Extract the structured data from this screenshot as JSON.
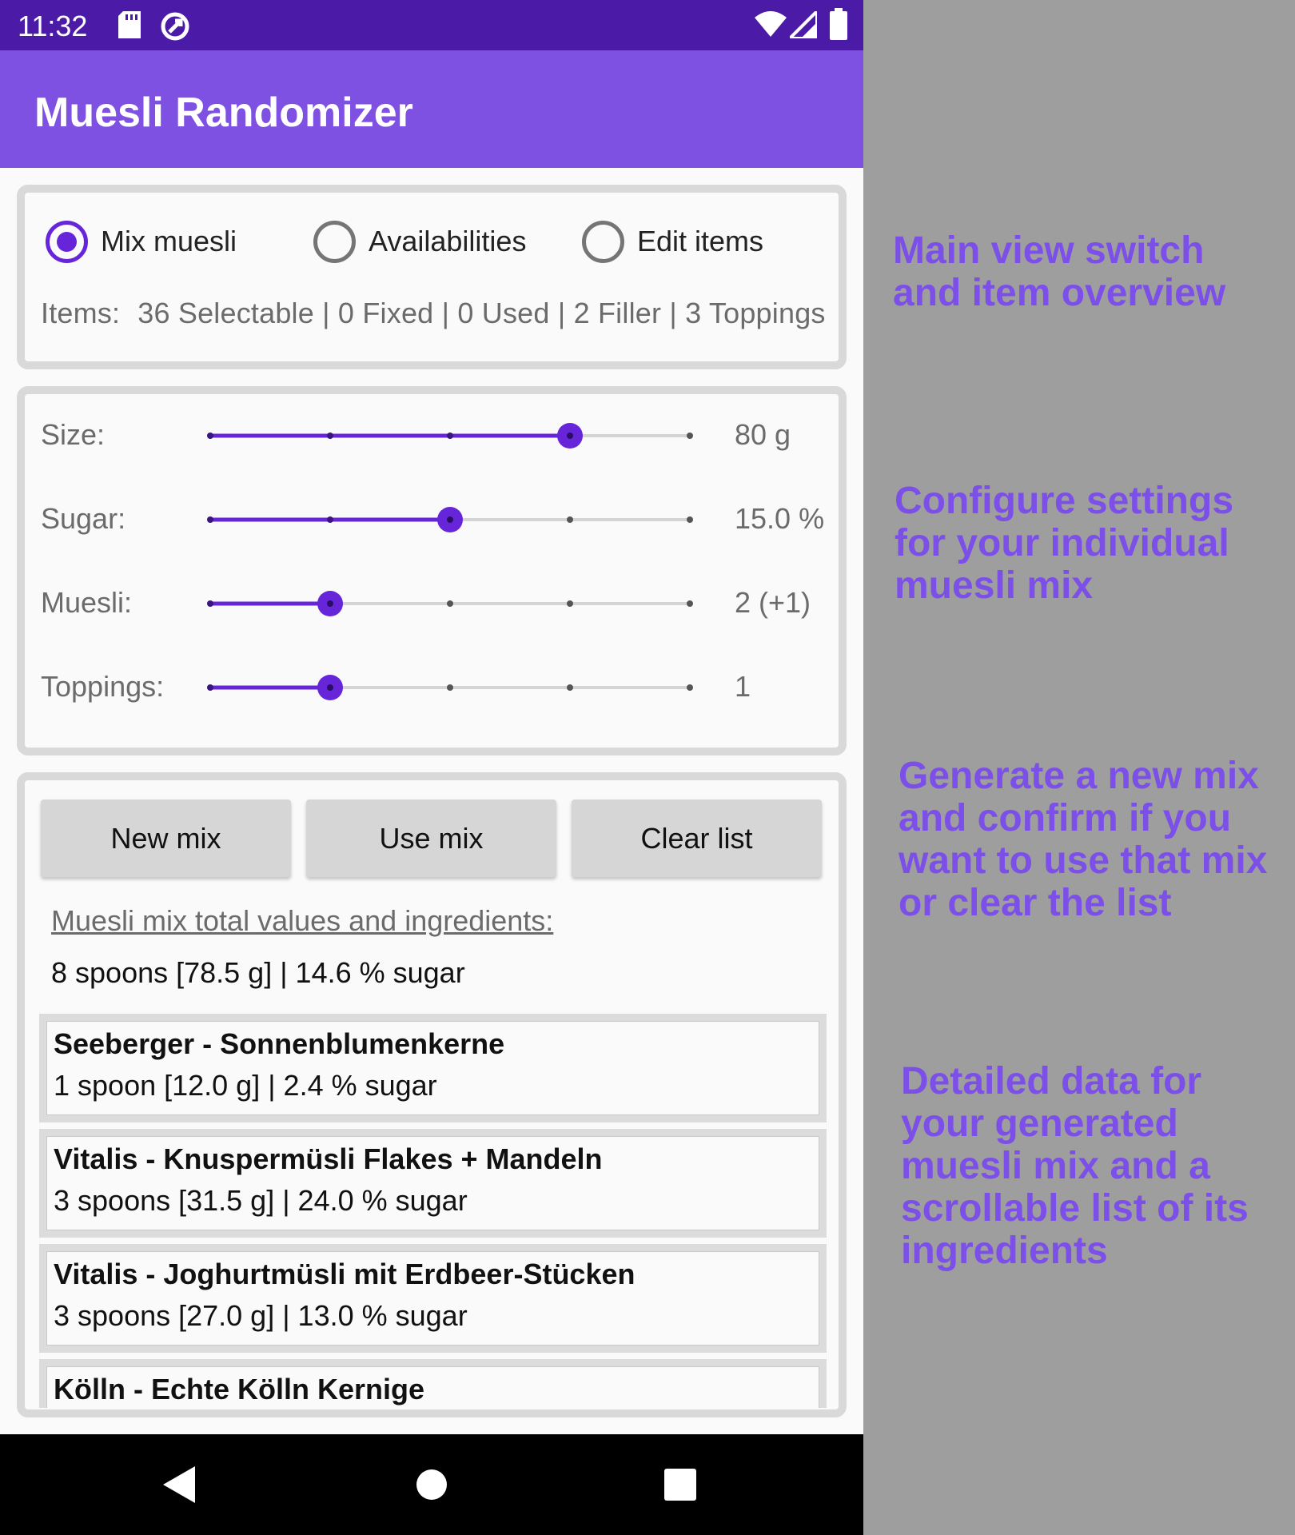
{
  "status_bar": {
    "time": "11:32",
    "icons": [
      "sd-card-icon",
      "sync-circle-icon",
      "wifi-icon",
      "signal-icon",
      "battery-icon"
    ]
  },
  "app_bar": {
    "title": "Muesli Randomizer",
    "color": "#7e51e3"
  },
  "view_switch": {
    "options": [
      {
        "label": "Mix muesli",
        "checked": true
      },
      {
        "label": "Availabilities",
        "checked": false
      },
      {
        "label": "Edit items",
        "checked": false
      }
    ],
    "items_label": "Items:",
    "items_summary": "36 Selectable | 0 Fixed | 0 Used | 2 Filler | 3 Toppings"
  },
  "settings": [
    {
      "label": "Size:",
      "value": "80 g",
      "steps": 5,
      "position": 3
    },
    {
      "label": "Sugar:",
      "value": "15.0 %",
      "steps": 5,
      "position": 2
    },
    {
      "label": "Muesli:",
      "value": "2 (+1)",
      "steps": 5,
      "position": 1
    },
    {
      "label": "Toppings:",
      "value": "1",
      "steps": 5,
      "position": 1
    }
  ],
  "actions": {
    "new_mix": "New mix",
    "use_mix": "Use mix",
    "clear_list": "Clear list"
  },
  "mix": {
    "title": "Muesli mix total values and ingredients:",
    "total": "8 spoons [78.5 g] | 14.6 % sugar",
    "ingredients": [
      {
        "name": "Seeberger - Sonnenblumenkerne",
        "detail": "1 spoon [12.0 g] | 2.4 % sugar"
      },
      {
        "name": "Vitalis - Knuspermüsli Flakes + Mandeln",
        "detail": "3 spoons [31.5 g] | 24.0 % sugar"
      },
      {
        "name": "Vitalis - Joghurtmüsli mit Erdbeer-Stücken",
        "detail": "3 spoons [27.0 g] | 13.0 % sugar"
      },
      {
        "name": "Kölln - Echte Kölln Kernige",
        "detail": ""
      }
    ]
  },
  "annotations": {
    "view": [
      "Main view switch",
      "and item overview"
    ],
    "settings": [
      "Configure settings",
      "for your individual",
      "muesli mix"
    ],
    "actions": [
      "Generate a new mix",
      "and confirm if you",
      "want to use that mix",
      "or clear the list"
    ],
    "details": [
      "Detailed data for",
      "your generated",
      "muesli mix and a",
      "scrollable list of its",
      "ingredients"
    ]
  },
  "colors": {
    "accent": "#6625d8",
    "status_bar": "#4b1ba8",
    "annotation": "#7c50e8",
    "background": "#9e9e9e"
  }
}
